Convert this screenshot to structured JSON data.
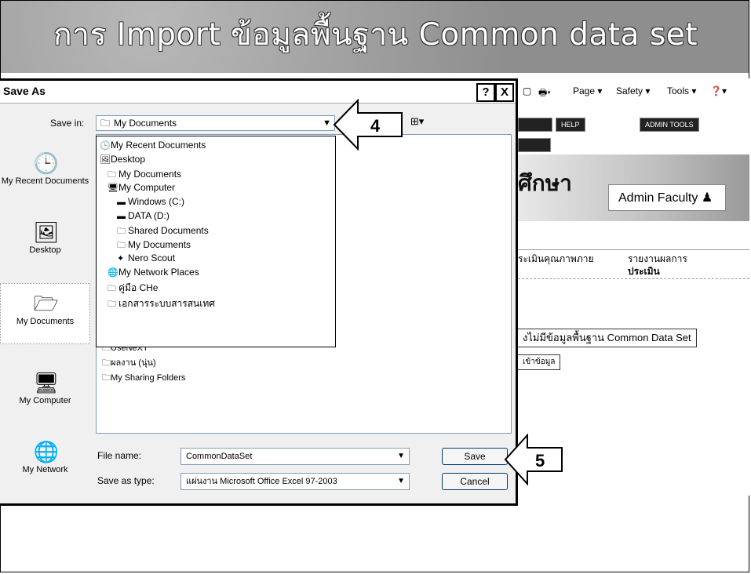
{
  "banner": {
    "title": "การ Import ข้อมูลพื้นฐาน Common data set"
  },
  "ie_toolbar": {
    "page": "Page ▾",
    "safety": "Safety ▾",
    "tools": "Tools ▾"
  },
  "bg_page": {
    "help": "HELP",
    "admin_tools": "ADMIN TOOLS",
    "thai_title": "ศึกษา",
    "admin_faculty": "Admin Faculty",
    "menu_1": "ระเมินคุณภาพภาย",
    "menu_2a": "รายงานผลการ",
    "menu_2b": "ประเมิน",
    "cds_button": "งไม่มีข้อมูลพื้นฐาน Common Data Set",
    "import_button": "เข้าข้อมูล"
  },
  "dialog": {
    "title": "Save As",
    "help_btn": "?",
    "close_btn": "X",
    "save_in_label": "Save in:",
    "save_in_value": "My Documents",
    "places": [
      {
        "label": "My Recent Documents"
      },
      {
        "label": "Desktop"
      },
      {
        "label": "My Documents"
      },
      {
        "label": "My Computer"
      },
      {
        "label": "My Network"
      }
    ],
    "dropdown_items": [
      "My Recent Documents",
      "Desktop",
      "My Documents",
      "My Computer",
      "Windows (C:)",
      "DATA (D:)",
      "Shared Documents",
      "My Documents",
      "Nero Scout",
      "My Network Places",
      "คู่มือ CHe",
      "เอกสารระบบสารสนเทศ"
    ],
    "files": [
      "UseNeXT",
      "ผลงาน (นุ่น)",
      "My Sharing Folders"
    ],
    "file_name_label": "File name:",
    "file_name_value": "CommonDataSet",
    "save_type_label": "Save as type:",
    "save_type_value": "แผ่นงาน Microsoft Office Excel 97-2003",
    "save_button": "Save",
    "cancel_button": "Cancel"
  },
  "callouts": {
    "step4": "4",
    "step5": "5"
  }
}
